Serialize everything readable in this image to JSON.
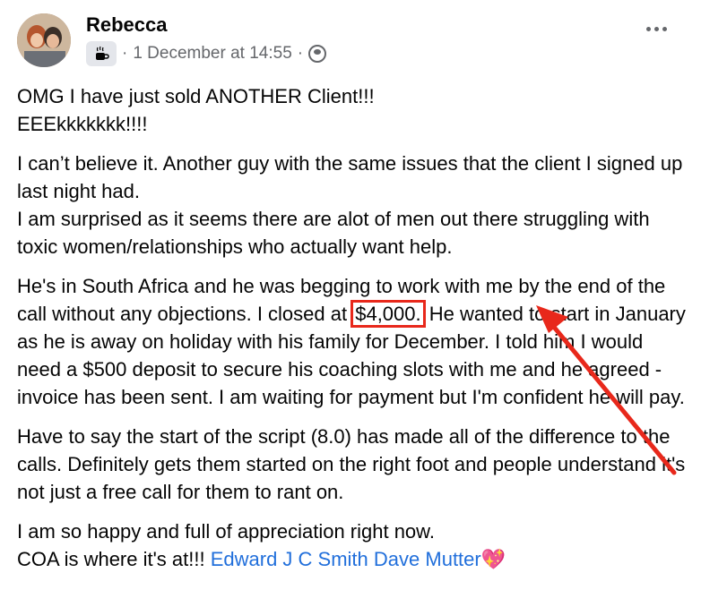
{
  "post": {
    "author": "Rebecca",
    "badge_icon": "coffee-cup-icon",
    "timestamp": "1 December at 14:55",
    "separator": "·",
    "audience_icon": "group-icon",
    "more_icon": "more-options-icon"
  },
  "body": {
    "p1": "OMG I have just sold ANOTHER Client!!!\nEEEkkkkkkk!!!!",
    "p2": "I can’t believe it. Another guy with the same issues that the client I signed up last night had.\nI am surprised as it seems there are alot of men out there struggling with toxic women/relationships who actually want help.",
    "p3_before": "He's in South Africa and he was begging to work with me by the end of the call without any objections. I closed at ",
    "p3_amount": "$4,000.",
    "p3_after": " He wanted to start in January as he is away on holiday with his family for December. I told him I would need a $500 deposit to secure his coaching slots with me and he agreed - invoice has been sent. I am waiting for payment but I'm confident he will pay.",
    "p4": "Have to say the start of the script (8.0) has made all of the difference to the calls. Definitely gets them started on the right foot and people understand it's not just a free call for them to rant on.",
    "p5_line1": "I am so happy and full of appreciation right now.",
    "p5_line2_text": "COA is where it's at!!! ",
    "mention_1": "Edward J C Smith",
    "mention_2": "Dave Mutter",
    "heart_icon": "sparkling-heart-icon"
  },
  "colors": {
    "highlight": "#e8281b",
    "mention": "#216fdb",
    "secondary_text": "#65676b"
  }
}
